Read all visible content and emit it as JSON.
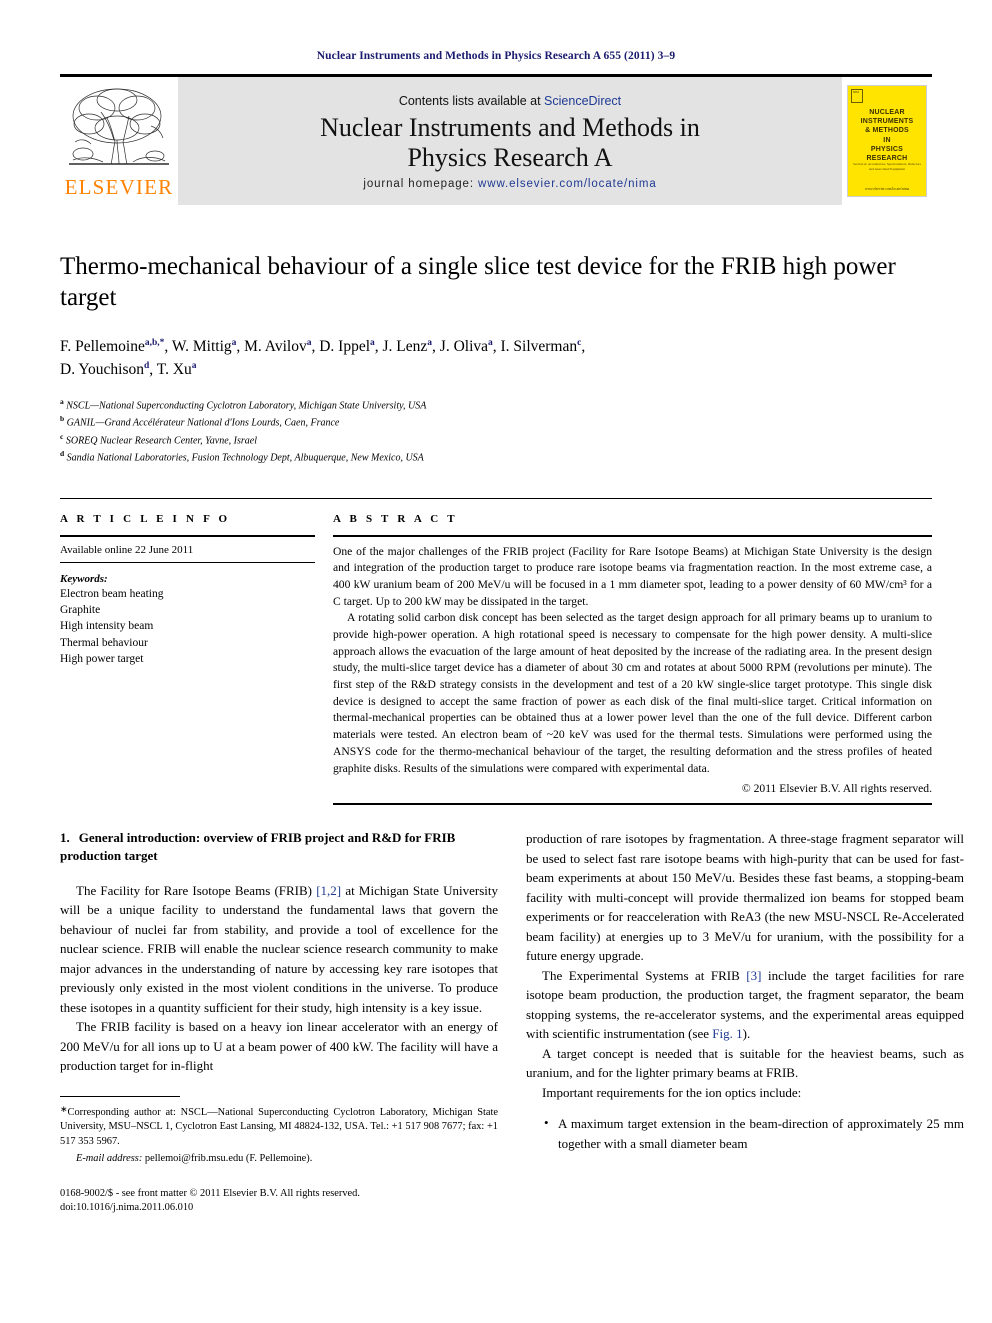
{
  "running_head": "Nuclear Instruments and Methods in Physics Research A 655 (2011) 3–9",
  "masthead": {
    "publisher_name": "ELSEVIER",
    "contents_prefix": "Contents lists available at ",
    "contents_link": "ScienceDirect",
    "journal_title": "Nuclear Instruments and Methods in Physics Research A",
    "homepage_prefix": "journal homepage: ",
    "homepage_url": "www.elsevier.com/locate/nima",
    "cover": {
      "badge_text": "NIM",
      "title_lines": [
        "NUCLEAR",
        "INSTRUMENTS",
        "& METHODS",
        "IN",
        "PHYSICS",
        "RESEARCH"
      ],
      "subtitle": "Section A: Accelerators, Spectrometers, Detectors and Associated Equipment",
      "footer": "www.elsevier.com/locate/nima",
      "background_color": "#ffe400"
    },
    "band_color": "#e3e3e3",
    "link_color": "#1f3a93",
    "brand_color": "#ff8200"
  },
  "article": {
    "title": "Thermo-mechanical behaviour of a single slice test device for the FRIB high power target",
    "authors_line1": "F. Pellemoine",
    "authors": [
      {
        "name": "F. Pellemoine",
        "sup": "a,b,*"
      },
      {
        "name": "W. Mittig",
        "sup": "a"
      },
      {
        "name": "M. Avilov",
        "sup": "a"
      },
      {
        "name": "D. Ippel",
        "sup": "a"
      },
      {
        "name": "J. Lenz",
        "sup": "a"
      },
      {
        "name": "J. Oliva",
        "sup": "a"
      },
      {
        "name": "I. Silverman",
        "sup": "c"
      },
      {
        "name": "D. Youchison",
        "sup": "d"
      },
      {
        "name": "T. Xu",
        "sup": "a"
      }
    ],
    "affiliations": [
      {
        "label": "a",
        "text": "NSCL—National Superconducting Cyclotron Laboratory, Michigan State University, USA"
      },
      {
        "label": "b",
        "text": "GANIL—Grand Accélérateur National d'Ions Lourds, Caen, France"
      },
      {
        "label": "c",
        "text": "SOREQ Nuclear Research Center, Yavne, Israel"
      },
      {
        "label": "d",
        "text": "Sandia National Laboratories, Fusion Technology Dept, Albuquerque, New Mexico, USA"
      }
    ]
  },
  "article_info": {
    "heading": "A R T I C L E  I N F O",
    "available_online": "Available online 22 June 2011",
    "keywords_label": "Keywords:",
    "keywords": [
      "Electron beam heating",
      "Graphite",
      "High intensity beam",
      "Thermal behaviour",
      "High power target"
    ]
  },
  "abstract": {
    "heading": "A B S T R A C T",
    "paragraphs": [
      "One of the major challenges of the FRIB project (Facility for Rare Isotope Beams) at Michigan State University is the design and integration of the production target to produce rare isotope beams via fragmentation reaction. In the most extreme case, a 400 kW uranium beam of 200 MeV/u will be focused in a 1 mm diameter spot, leading to a power density of 60 MW/cm³ for a C target. Up to 200 kW may be dissipated in the target.",
      "A rotating solid carbon disk concept has been selected as the target design approach for all primary beams up to uranium to provide high-power operation. A high rotational speed is necessary to compensate for the high power density. A multi-slice approach allows the evacuation of the large amount of heat deposited by the increase of the radiating area. In the present design study, the multi-slice target device has a diameter of about 30 cm and rotates at about 5000 RPM (revolutions per minute). The first step of the R&D strategy consists in the development and test of a 20 kW single-slice target prototype. This single disk device is designed to accept the same fraction of power as each disk of the final multi-slice target. Critical information on thermal-mechanical properties can be obtained thus at a lower power level than the one of the full device. Different carbon materials were tested. An electron beam of ~20 keV was used for the thermal tests. Simulations were performed using the ANSYS code for the thermo-mechanical behaviour of the target, the resulting deformation and the stress profiles of heated graphite disks. Results of the simulations were compared with experimental data."
    ],
    "copyright": "© 2011 Elsevier B.V. All rights reserved."
  },
  "body": {
    "section_number": "1.",
    "section_title": "General introduction: overview of FRIB project and R&D for FRIB production target",
    "left_paragraphs": [
      "The Facility for Rare Isotope Beams (FRIB) [1,2] at Michigan State University will be a unique facility to understand the fundamental laws that govern the behaviour of nuclei far from stability, and provide a tool of excellence for the nuclear science. FRIB will enable the nuclear science research community to make major advances in the understanding of nature by accessing key rare isotopes that previously only existed in the most violent conditions in the universe. To produce these isotopes in a quantity sufficient for their study, high intensity is a key issue.",
      "The FRIB facility is based on a heavy ion linear accelerator with an energy of 200 MeV/u for all ions up to U at a beam power of 400 kW. The facility will have a production target for in-flight"
    ],
    "right_paragraphs": [
      "production of rare isotopes by fragmentation. A three-stage fragment separator will be used to select fast rare isotope beams with high-purity that can be used for fast-beam experiments at about 150 MeV/u. Besides these fast beams, a stopping-beam facility with multi-concept will provide thermalized ion beams for stopped beam experiments or for reacceleration with ReA3 (the new MSU-NSCL Re-Accelerated beam facility) at energies up to 3 MeV/u for uranium, with the possibility for a future energy upgrade.",
      "The Experimental Systems at FRIB [3] include the target facilities for rare isotope beam production, the production target, the fragment separator, the beam stopping systems, the re-accelerator systems, and the experimental areas equipped with scientific instrumentation (see Fig. 1).",
      "A target concept is needed that is suitable for the heaviest beams, such as uranium, and for the lighter primary beams at FRIB.",
      "Important requirements for the ion optics include:"
    ],
    "bullets": [
      "A maximum target extension in the beam-direction of approximately 25 mm together with a small diameter beam"
    ],
    "inline_refs": [
      "[1,2]",
      "[3]",
      "Fig. 1"
    ]
  },
  "footnotes": {
    "corresponding": "Corresponding author at: NSCL—National Superconducting Cyclotron Laboratory, Michigan State University, MSU–NSCL 1, Cyclotron East Lansing, MI 48824-132, USA. Tel.: +1 517 908 7677; fax: +1 517 353 5967.",
    "email_label": "E-mail address:",
    "email_value": "pellemoi@frib.msu.edu (F. Pellemoine).",
    "issn_line": "0168-9002/$ - see front matter © 2011 Elsevier B.V. All rights reserved.",
    "doi_line": "doi:10.1016/j.nima.2011.06.010"
  }
}
